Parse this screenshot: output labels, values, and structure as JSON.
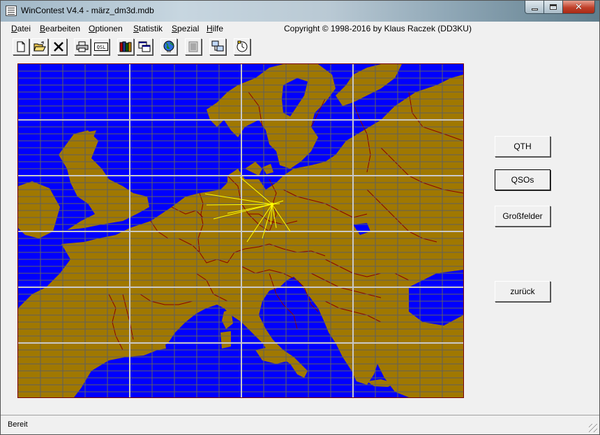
{
  "window": {
    "title": "WinContest V4.4 -  märz_dm3d.mdb",
    "controls": {
      "minimize": "minimize",
      "maximize": "maximize",
      "close": "close"
    }
  },
  "menu": {
    "items": [
      "Datei",
      "Bearbeiten",
      "Optionen",
      "Statistik",
      "Spezial",
      "Hilfe"
    ],
    "copyright": "Copyright © 1998-2016 by Klaus Raczek (DD3KU)"
  },
  "toolbar": {
    "buttons": [
      {
        "icon": "new-document-icon"
      },
      {
        "icon": "open-folder-icon"
      },
      {
        "icon": "delete-x-icon"
      },
      {
        "icon": "printer-icon"
      },
      {
        "icon": "qsl-card-icon",
        "label": "QSL"
      },
      {
        "icon": "books-icon"
      },
      {
        "icon": "copy-windows-icon"
      },
      {
        "icon": "globe-icon"
      },
      {
        "icon": "list-table-icon"
      },
      {
        "icon": "network-computers-icon"
      },
      {
        "icon": "info-clock-icon"
      }
    ]
  },
  "map": {
    "description_colors": {
      "sea": "#0000ff",
      "land": "#a07800",
      "borders": "#8b0000",
      "grid": "#606060",
      "major_grid": "#c8c8c8",
      "qso_lines": "#ffff00"
    }
  },
  "side_buttons": {
    "qth": "QTH",
    "qsos": "QSOs",
    "grossfelder": "Großfelder",
    "back": "zurück"
  },
  "status": {
    "text": "Bereit"
  }
}
